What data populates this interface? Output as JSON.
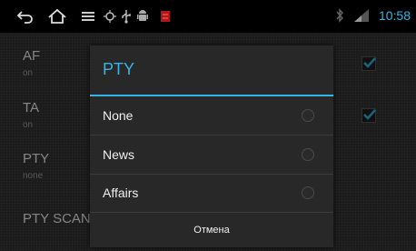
{
  "status_bar": {
    "time": "10:58",
    "icons": [
      "back-icon",
      "home-icon",
      "menu-icon",
      "gps-icon",
      "usb-icon",
      "android-debug-icon",
      "notification-icon",
      "bluetooth-icon",
      "signal-icon"
    ]
  },
  "settings": [
    {
      "title": "AF",
      "subtitle": "on",
      "checked": true
    },
    {
      "title": "TA",
      "subtitle": "on",
      "checked": true
    },
    {
      "title": "PTY",
      "subtitle": "none"
    },
    {
      "title": "PTY SCAN"
    }
  ],
  "dialog": {
    "title": "PTY",
    "options": [
      "None",
      "News",
      "Affairs"
    ],
    "cancel_label": "Отмена"
  },
  "colors": {
    "accent": "#33b5e5",
    "background": "#2e2e2e",
    "dialog": "#282828"
  }
}
